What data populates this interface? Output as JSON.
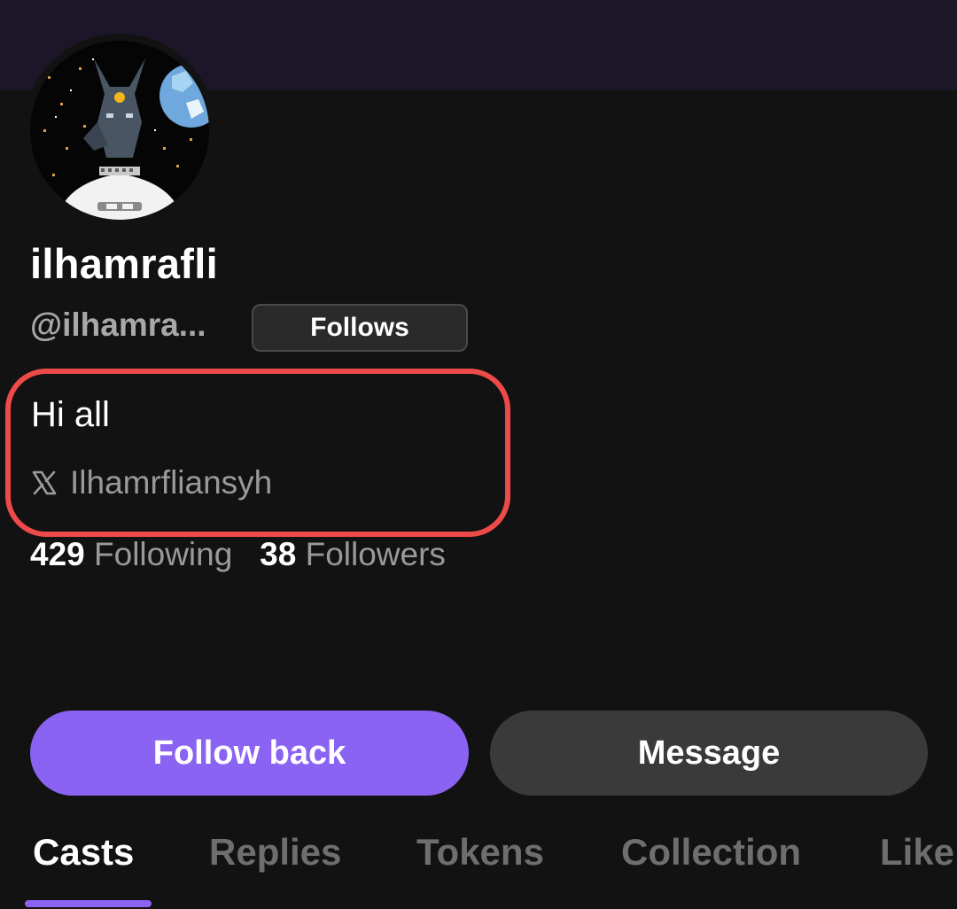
{
  "profile": {
    "display_name": "ilhamrafli",
    "handle": "@ilhamra...",
    "follows_badge": "Follows",
    "bio": "Hi all",
    "x_account": "Ilhamrfliansyh",
    "following_count": "429",
    "following_label": "Following",
    "followers_count": "38",
    "followers_label": "Followers"
  },
  "actions": {
    "follow_back": "Follow back",
    "message": "Message"
  },
  "tabs": [
    {
      "label": "Casts",
      "active": true
    },
    {
      "label": "Replies",
      "active": false
    },
    {
      "label": "Tokens",
      "active": false
    },
    {
      "label": "Collection",
      "active": false
    },
    {
      "label": "Like",
      "active": false
    }
  ],
  "colors": {
    "accent": "#8a63f2",
    "highlight": "#ee4a4a",
    "background": "#121212",
    "banner": "#1c1628"
  },
  "icons": {
    "social": "x-logo-icon",
    "avatar": "anubis-astronaut-avatar"
  }
}
